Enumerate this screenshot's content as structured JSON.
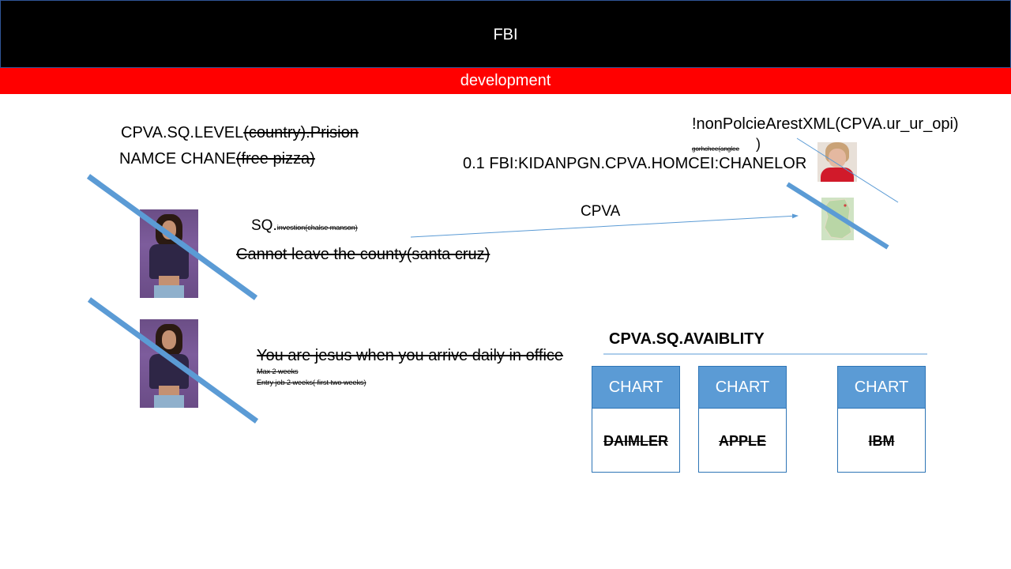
{
  "header": {
    "title": "FBI",
    "band_label": "development"
  },
  "texts": {
    "level_prefix": "CPVA.SQ.LEVEL",
    "level_struck": "(country).Prision",
    "name_prefix": "NAMCE CHANE",
    "name_struck": "(free pizza)",
    "sq_prefix": "SQ.",
    "sq_struck": "investion(chalse manson)",
    "county": "Cannot leave the county(santa cruz)",
    "jesus": "You are jesus when you arrive daily in office",
    "max": "Max 2 weeks",
    "entry": "Entry job 2 weeks( first two weeks)",
    "cpva_arrow": "CPVA",
    "fbi_line": "0.1 FBI:KIDANPGN.CPVA.HOMCEI:CHANELOR",
    "nonpolice": "!nonPolcieArestXML(CPVA.ur_ur_opi)",
    "gorhchee": "gorhchee(anglee",
    "close_paren": ")",
    "availability": "CPVA.SQ.AVAIBLITY"
  },
  "cards": [
    {
      "header": "CHART",
      "name": "DAIMLER"
    },
    {
      "header": "CHART",
      "name": "APPLE"
    },
    {
      "header": "CHART",
      "name": "IBM"
    }
  ],
  "colors": {
    "band": "#ff0000",
    "accent": "#5b9bd5",
    "strike_line": "#5b9bd5"
  }
}
